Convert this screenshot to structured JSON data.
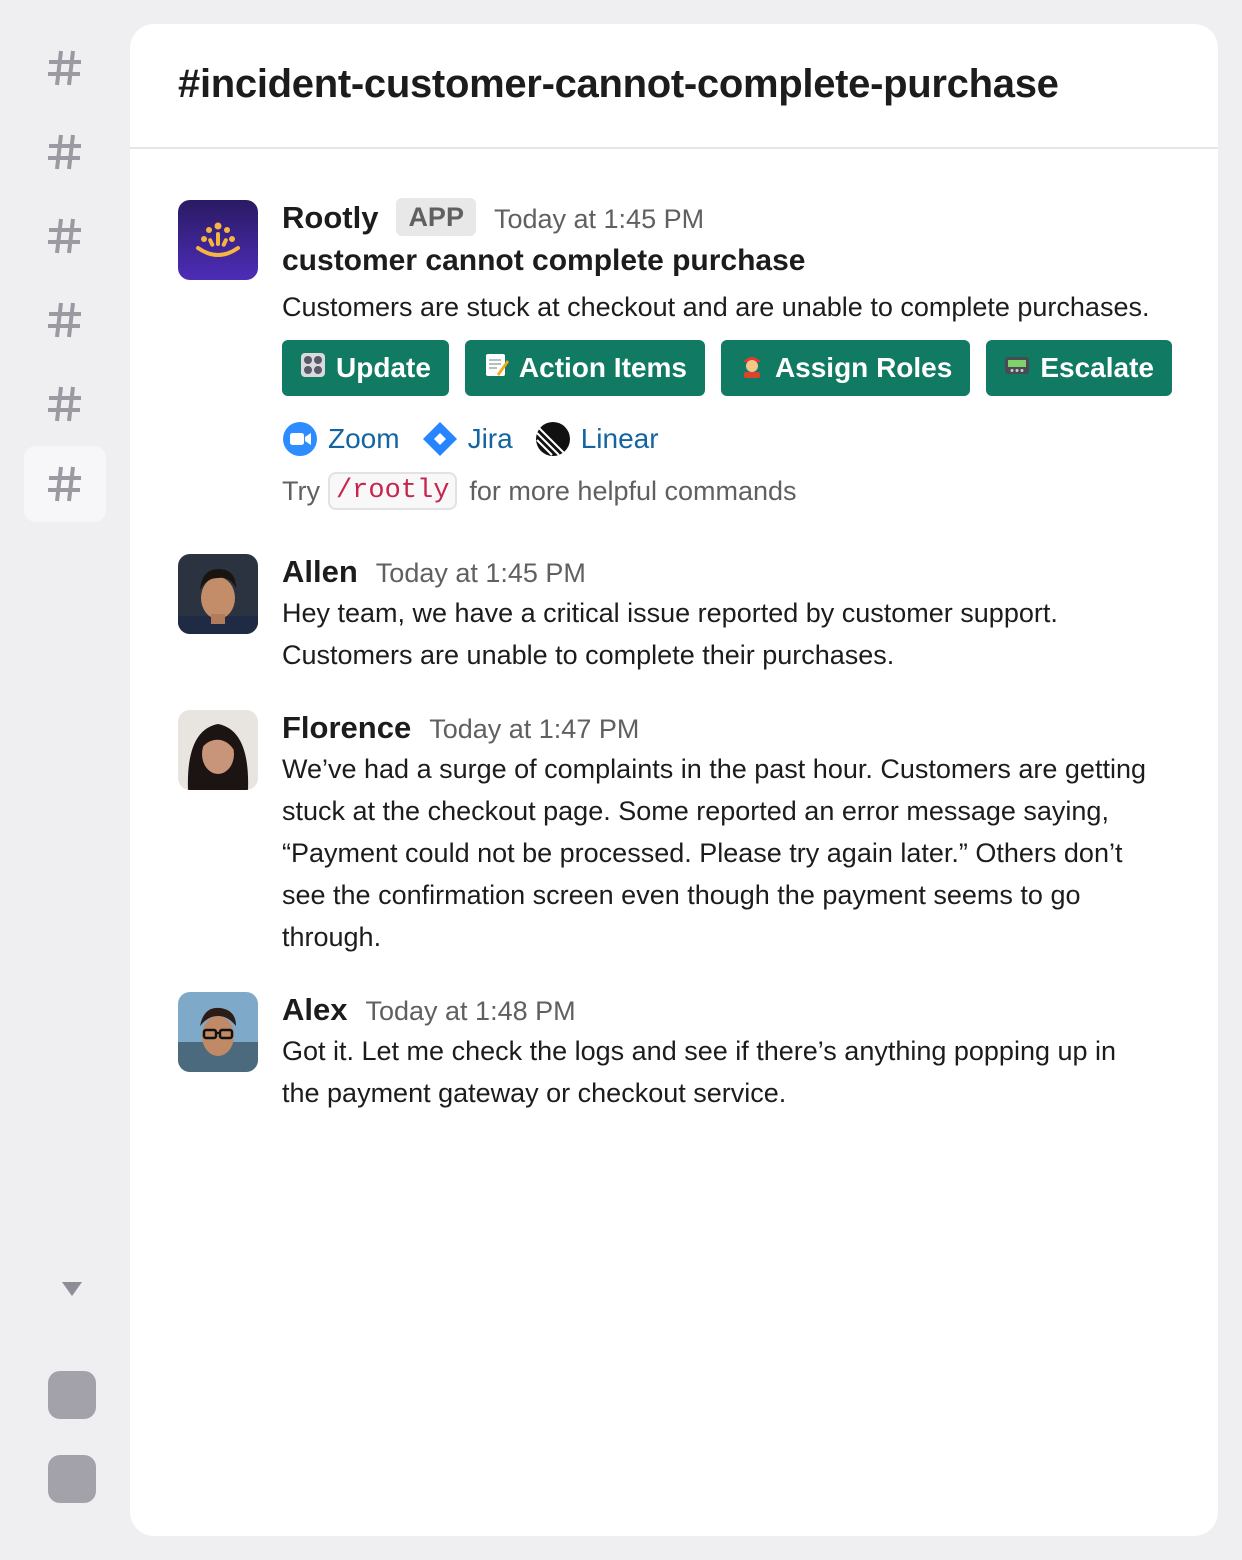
{
  "rail": {
    "items": [
      "#",
      "#",
      "#",
      "#",
      "#",
      "#"
    ],
    "active_index": 5
  },
  "channel": {
    "title": "#incident-customer-cannot-complete-purchase"
  },
  "messages": [
    {
      "author": "Rootly",
      "badge": "APP",
      "time": "Today at 1:45 PM",
      "title": "customer cannot complete purchase",
      "text": "Customers are stuck at checkout and are unable to complete purchases.",
      "buttons": [
        {
          "label": "Update",
          "icon": "control-knobs-icon"
        },
        {
          "label": "Action Items",
          "icon": "memo-icon"
        },
        {
          "label": "Assign Roles",
          "icon": "firefighter-icon"
        },
        {
          "label": "Escalate",
          "icon": "pager-icon"
        }
      ],
      "links": [
        {
          "label": "Zoom",
          "icon": "zoom-icon"
        },
        {
          "label": "Jira",
          "icon": "jira-icon"
        },
        {
          "label": "Linear",
          "icon": "linear-icon"
        }
      ],
      "hint_prefix": "Try",
      "hint_command": "/rootly",
      "hint_suffix": "for more helpful commands"
    },
    {
      "author": "Allen",
      "time": "Today at 1:45 PM",
      "lines": [
        "Hey team, we have a critical issue reported by customer support.",
        "Customers are unable to complete their purchases."
      ]
    },
    {
      "author": "Florence",
      "time": "Today at 1:47 PM",
      "lines": [
        "We’ve had a surge of complaints in the past hour. Customers are getting",
        "stuck at the checkout page. Some reported an error message saying,",
        "“Payment could not be processed. Please try again later.” Others don’t",
        "see the confirmation screen even though the payment seems to go",
        "through."
      ]
    },
    {
      "author": "Alex",
      "time": "Today at 1:48 PM",
      "lines": [
        "Got it. Let me check the logs and see if there’s anything popping up in",
        "the payment gateway or checkout service."
      ]
    }
  ],
  "colors": {
    "button_bg": "#117a63",
    "link": "#1264a3",
    "code": "#c7254e",
    "rail_bg": "#efeef1"
  }
}
